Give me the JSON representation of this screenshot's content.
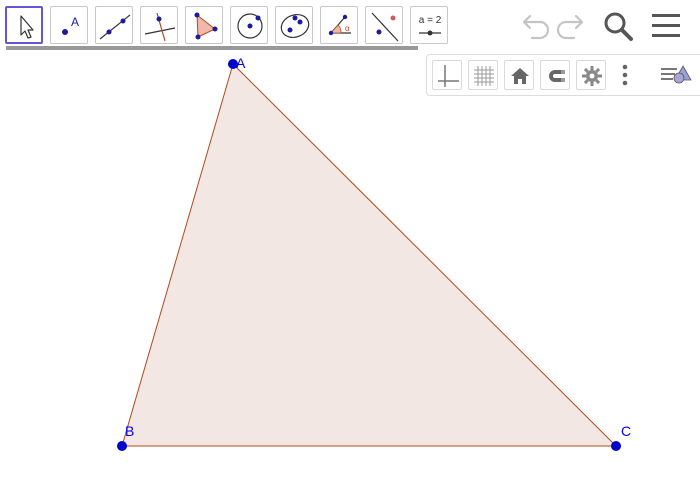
{
  "toolbar": {
    "tools": [
      {
        "name": "move-tool"
      },
      {
        "name": "point-tool",
        "icon_label": "A"
      },
      {
        "name": "line-tool"
      },
      {
        "name": "perpendicular-line-tool"
      },
      {
        "name": "polygon-tool"
      },
      {
        "name": "circle-center-point-tool"
      },
      {
        "name": "conic-tool"
      },
      {
        "name": "angle-tool"
      },
      {
        "name": "reflect-tool"
      },
      {
        "name": "slider-tool",
        "icon_label": "a = 2"
      }
    ],
    "selected_tool": "move-tool"
  },
  "actions": {
    "undo_icon": "undo-icon",
    "redo_icon": "redo-icon",
    "search_icon": "search-icon",
    "menu_icon": "hamburger-menu-icon"
  },
  "style_bar": {
    "buttons": [
      "axes-icon",
      "grid-icon",
      "home-icon",
      "magnet-icon",
      "gear-icon",
      "more-vertical-icon",
      "toggle-algebra-icon"
    ]
  },
  "construction": {
    "points": [
      {
        "label": "A"
      },
      {
        "label": "B"
      },
      {
        "label": "C"
      }
    ],
    "polygon": {
      "vertices": [
        "A",
        "B",
        "C"
      ],
      "fill": "#f3e7e3",
      "stroke": "#b04a1c"
    },
    "point_color": "#0000cc"
  },
  "colors": {
    "accent": "#6557d2",
    "icon_gray": "#666666",
    "disabled_gray": "#c4c4c4"
  }
}
